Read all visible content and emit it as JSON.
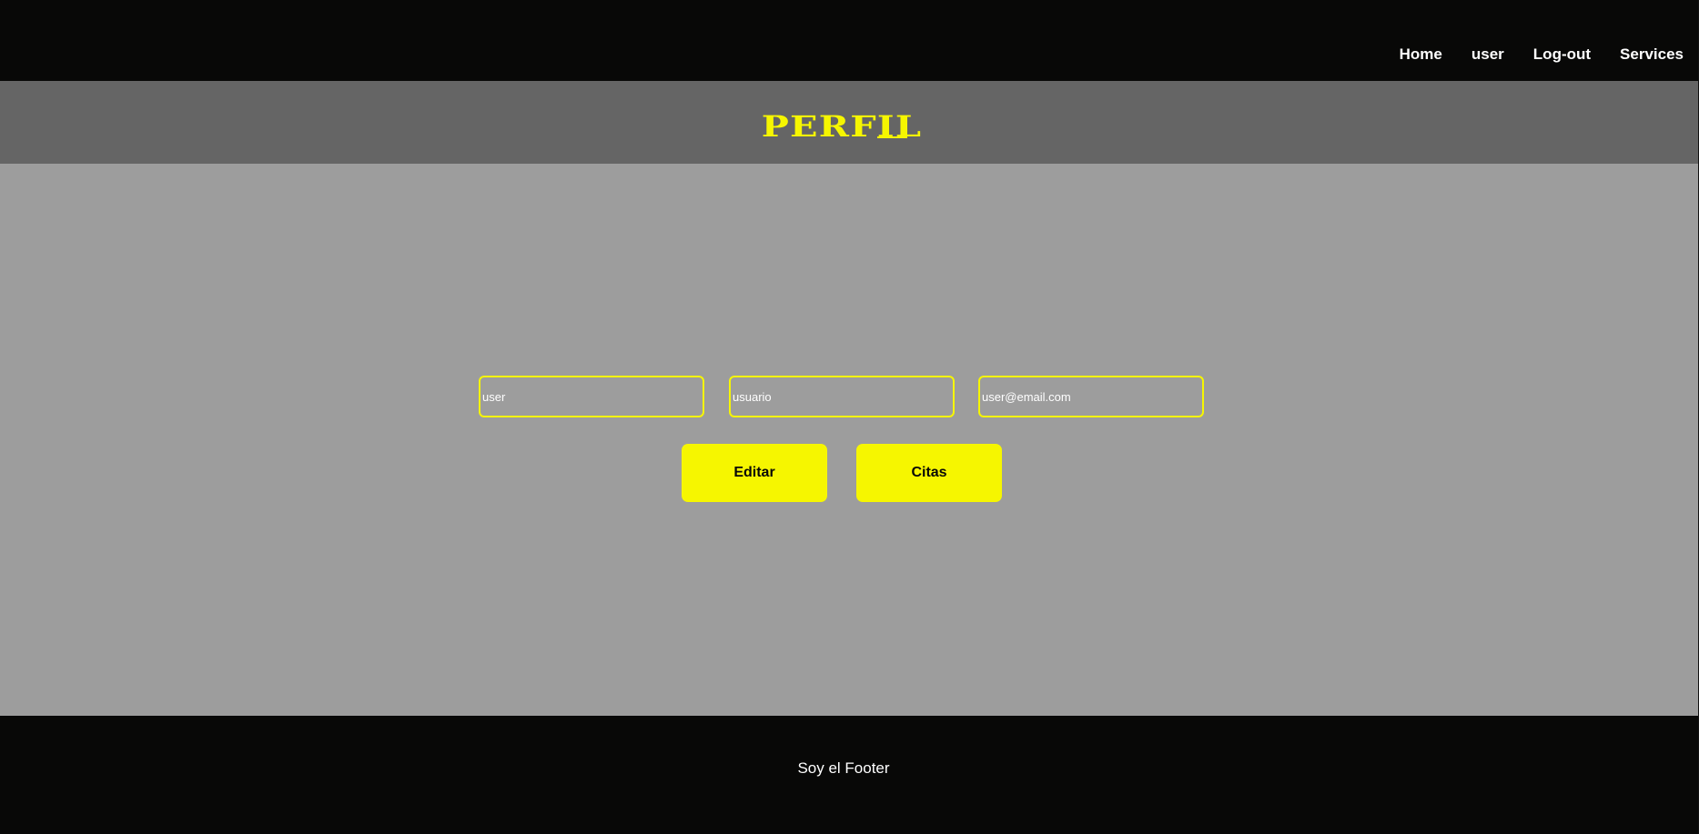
{
  "navbar": {
    "links": [
      "Home",
      "user",
      "Log-out",
      "Services"
    ]
  },
  "header": {
    "title": "PERFIL"
  },
  "profile_form": {
    "name_value": "user",
    "username_value": "usuario",
    "email_value": "user@email.com"
  },
  "actions": {
    "edit_label": "Editar",
    "appointments_label": "Citas"
  },
  "footer": {
    "text": "Soy el Footer"
  },
  "colors": {
    "navbar_bg": "#080807",
    "header_bg": "#656565",
    "main_bg": "#9d9d9d",
    "accent": "#f6f600",
    "text_light": "#ffffff",
    "button_text": "#080807"
  },
  "icons": []
}
